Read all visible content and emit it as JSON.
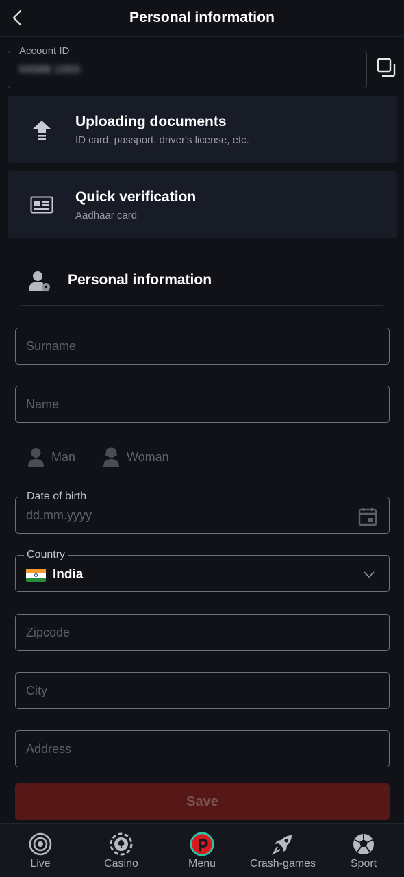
{
  "header": {
    "title": "Personal information"
  },
  "account": {
    "label": "Account ID",
    "value": "94588 1003"
  },
  "cards": [
    {
      "title": "Uploading documents",
      "subtitle": "ID card, passport, driver's license, etc.",
      "icon": "upload-icon"
    },
    {
      "title": "Quick verification",
      "subtitle": "Aadhaar card",
      "icon": "id-card-icon"
    }
  ],
  "section": {
    "title": "Personal information"
  },
  "form": {
    "surname_placeholder": "Surname",
    "name_placeholder": "Name",
    "gender_man": "Man",
    "gender_woman": "Woman",
    "dob_label": "Date of birth",
    "dob_placeholder": "dd.mm.yyyy",
    "country_label": "Country",
    "country_value": "India",
    "zipcode_placeholder": "Zipcode",
    "city_placeholder": "City",
    "address_placeholder": "Address",
    "save_label": "Save"
  },
  "nav": {
    "live": "Live",
    "casino": "Casino",
    "menu": "Menu",
    "crash": "Crash-games",
    "sport": "Sport"
  },
  "colors": {
    "save_bg": "#561717",
    "menu_accent": "#d71920",
    "menu_ring": "#2ec4a6"
  }
}
